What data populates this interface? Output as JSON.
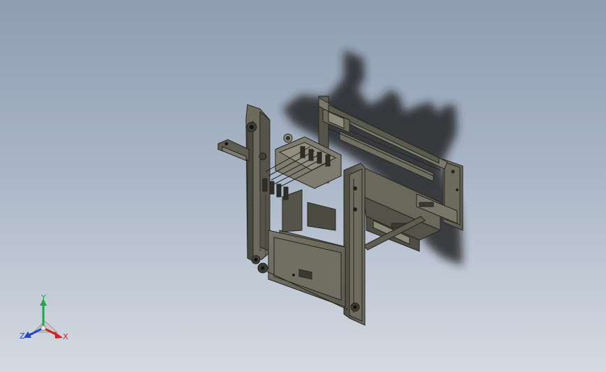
{
  "viewport": {
    "background_top": "#8e9db2",
    "background_bottom": "#d5dae2",
    "model_color": "#6b6a58",
    "model_edge_color": "#262622",
    "shadow_color": "#1a1a1a"
  },
  "triad": {
    "y_label": "Y",
    "z_label": "Z",
    "x_label": "X",
    "y_color": "#1aa84a",
    "z_color": "#2244cc",
    "x_color": "#cc2222"
  }
}
